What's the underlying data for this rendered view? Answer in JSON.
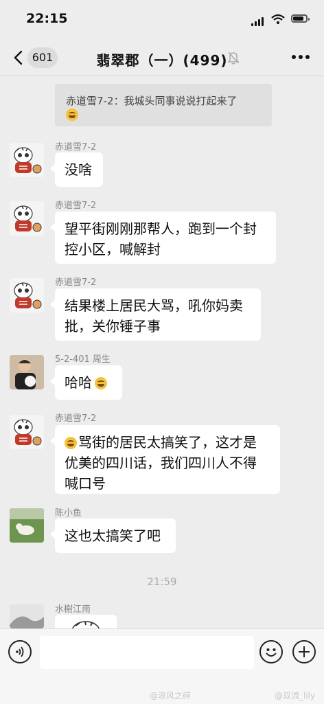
{
  "status_bar": {
    "time": "22:15",
    "battery_level": 0.85
  },
  "nav": {
    "back_count": "601",
    "title": "翡翠郡（一）(499)"
  },
  "messages": {
    "quoted": {
      "text": "赤道雪7-2：我城头同事说说打起来了"
    },
    "m1": {
      "sender": "赤道雪7-2",
      "lines": [
        "没啥"
      ]
    },
    "m2": {
      "sender": "赤道雪7-2",
      "lines": [
        "望平街刚刚那帮人，跑到一个封",
        "控小区，喊解封"
      ]
    },
    "m3": {
      "sender": "赤道雪7-2",
      "lines": [
        "结果楼上居民大骂，吼你妈卖",
        "批，关你锤子事"
      ]
    },
    "m4": {
      "sender": "5-2-401 周生",
      "lines": [
        "哈哈"
      ]
    },
    "m5": {
      "sender": "赤道雪7-2",
      "lines": [
        "骂街的居民太搞笑了，这才是",
        "优美的四川话，我们四川人不得",
        "喊口号"
      ]
    },
    "m6": {
      "sender": "陈小鱼",
      "lines": [
        "这也太搞笑了吧"
      ]
    },
    "timestamp": "21:59",
    "m7": {
      "sender": "水榭江南"
    }
  },
  "input": {
    "placeholder": ""
  },
  "watermarks": {
    "left": "@浪风之碎",
    "right": "@双流_lily"
  },
  "colors": {
    "background": "#ededed",
    "bubble": "#ffffff",
    "input_bar": "#f6f6f6",
    "sender_text": "#888888"
  },
  "icons": [
    "back-arrow-icon",
    "mute-bell-icon",
    "more-icon",
    "voice-icon",
    "emoji-icon",
    "plus-icon"
  ]
}
